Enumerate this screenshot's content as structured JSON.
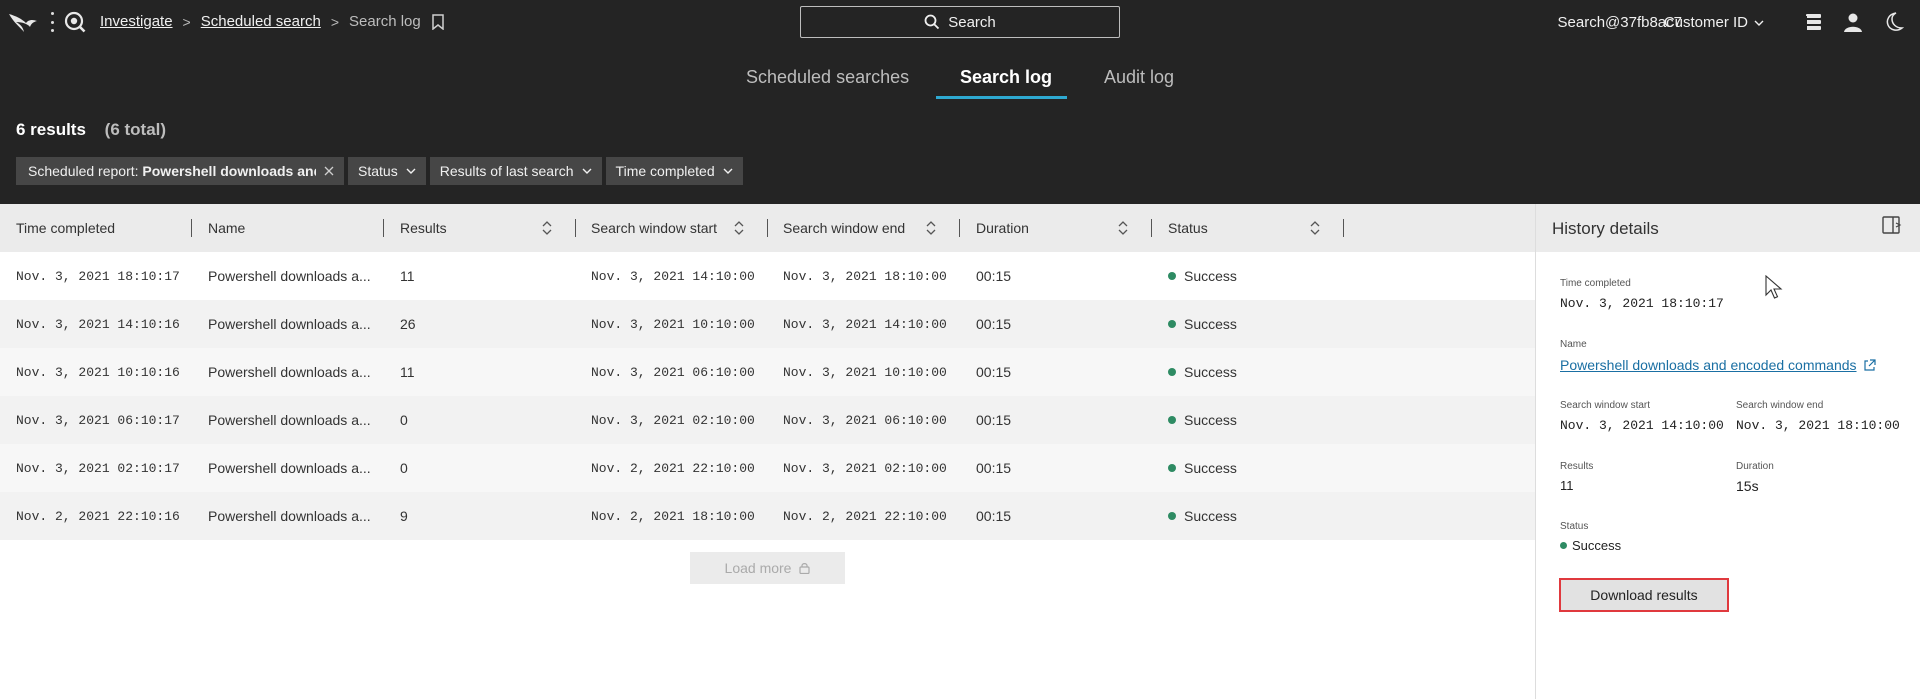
{
  "header": {
    "breadcrumb": {
      "investigate": "Investigate",
      "scheduled_search": "Scheduled search",
      "current": "Search log"
    },
    "search_label": "Search",
    "user": "Search@37fb8ac7",
    "customer_id": "Customer ID"
  },
  "tabs": [
    {
      "label": "Scheduled searches",
      "active": false
    },
    {
      "label": "Search log",
      "active": true
    },
    {
      "label": "Audit log",
      "active": false
    }
  ],
  "summary": {
    "results": "6 results",
    "total": "(6 total)"
  },
  "filters": {
    "scheduled_report_prefix": "Scheduled report:",
    "scheduled_report_value": "Powershell downloads and encoded commands",
    "status": "Status",
    "results_of_last_search": "Results of last search",
    "time_completed": "Time completed"
  },
  "table": {
    "columns": [
      "Time completed",
      "Name",
      "Results",
      "Search window start",
      "Search window end",
      "Duration",
      "Status"
    ],
    "rows": [
      {
        "time": "Nov. 3, 2021 18:10:17",
        "name": "Powershell downloads a...",
        "results": "11",
        "start": "Nov. 3, 2021 14:10:00",
        "end": "Nov. 3, 2021 18:10:00",
        "duration": "00:15",
        "status": "Success"
      },
      {
        "time": "Nov. 3, 2021 14:10:16",
        "name": "Powershell downloads a...",
        "results": "26",
        "start": "Nov. 3, 2021 10:10:00",
        "end": "Nov. 3, 2021 14:10:00",
        "duration": "00:15",
        "status": "Success"
      },
      {
        "time": "Nov. 3, 2021 10:10:16",
        "name": "Powershell downloads a...",
        "results": "11",
        "start": "Nov. 3, 2021 06:10:00",
        "end": "Nov. 3, 2021 10:10:00",
        "duration": "00:15",
        "status": "Success"
      },
      {
        "time": "Nov. 3, 2021 06:10:17",
        "name": "Powershell downloads a...",
        "results": "0",
        "start": "Nov. 3, 2021 02:10:00",
        "end": "Nov. 3, 2021 06:10:00",
        "duration": "00:15",
        "status": "Success"
      },
      {
        "time": "Nov. 3, 2021 02:10:17",
        "name": "Powershell downloads a...",
        "results": "0",
        "start": "Nov. 2, 2021 22:10:00",
        "end": "Nov. 3, 2021 02:10:00",
        "duration": "00:15",
        "status": "Success"
      },
      {
        "time": "Nov. 2, 2021 22:10:16",
        "name": "Powershell downloads a...",
        "results": "9",
        "start": "Nov. 2, 2021 18:10:00",
        "end": "Nov. 2, 2021 22:10:00",
        "duration": "00:15",
        "status": "Success"
      }
    ],
    "load_more": "Load more"
  },
  "details": {
    "title": "History details",
    "time_completed_label": "Time completed",
    "time_completed": "Nov. 3, 2021 18:10:17",
    "name_label": "Name",
    "name": "Powershell downloads and encoded commands",
    "start_label": "Search window start",
    "start": "Nov. 3, 2021 14:10:00",
    "end_label": "Search window end",
    "end": "Nov. 3, 2021 18:10:00",
    "results_label": "Results",
    "results": "11",
    "duration_label": "Duration",
    "duration": "15s",
    "status_label": "Status",
    "status": "Success",
    "download_label": "Download results"
  },
  "colors": {
    "header_bg": "#242424",
    "accent_tab": "#2ea9d1",
    "success": "#2e8b63",
    "highlight_border": "#e0393e",
    "link": "#1a6fa3"
  },
  "icons": [
    "falcon-logo-icon",
    "menu-dots-icon",
    "investigate-app-icon",
    "bookmark-icon",
    "search-icon",
    "chevron-down-icon",
    "news-feed-icon",
    "user-icon",
    "moon-icon",
    "sort-icon",
    "lock-icon",
    "collapse-panel-icon",
    "external-link-icon",
    "mouse-cursor-icon"
  ]
}
